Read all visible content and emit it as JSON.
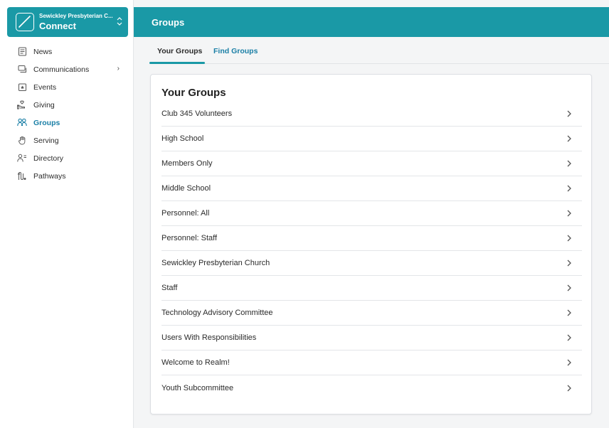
{
  "org": {
    "name": "Sewickley Presbyterian C...",
    "app": "Connect",
    "chevron": "⌃⌄"
  },
  "header": {
    "title": "Groups"
  },
  "sidebar": {
    "items": [
      {
        "label": "News",
        "icon": "news-icon"
      },
      {
        "label": "Communications",
        "icon": "chat-icon",
        "caret": "›"
      },
      {
        "label": "Events",
        "icon": "calendar-star-icon"
      },
      {
        "label": "Giving",
        "icon": "giving-hand-icon"
      },
      {
        "label": "Groups",
        "icon": "groups-icon",
        "active": true
      },
      {
        "label": "Serving",
        "icon": "hand-icon"
      },
      {
        "label": "Directory",
        "icon": "directory-icon"
      },
      {
        "label": "Pathways",
        "icon": "pathways-icon"
      }
    ]
  },
  "tabs": {
    "your_groups": "Your Groups",
    "find_groups": "Find Groups"
  },
  "card": {
    "title": "Your Groups",
    "groups": [
      "Club 345 Volunteers",
      "High School",
      "Members Only",
      "Middle School",
      "Personnel: All",
      "Personnel: Staff",
      "Sewickley Presbyterian Church",
      "Staff",
      "Technology Advisory Committee",
      "Users With Responsibilities",
      "Welcome to Realm!",
      "Youth Subcommittee"
    ]
  },
  "colors": {
    "brand": "#1a99a6",
    "link": "#1a7fa6"
  }
}
